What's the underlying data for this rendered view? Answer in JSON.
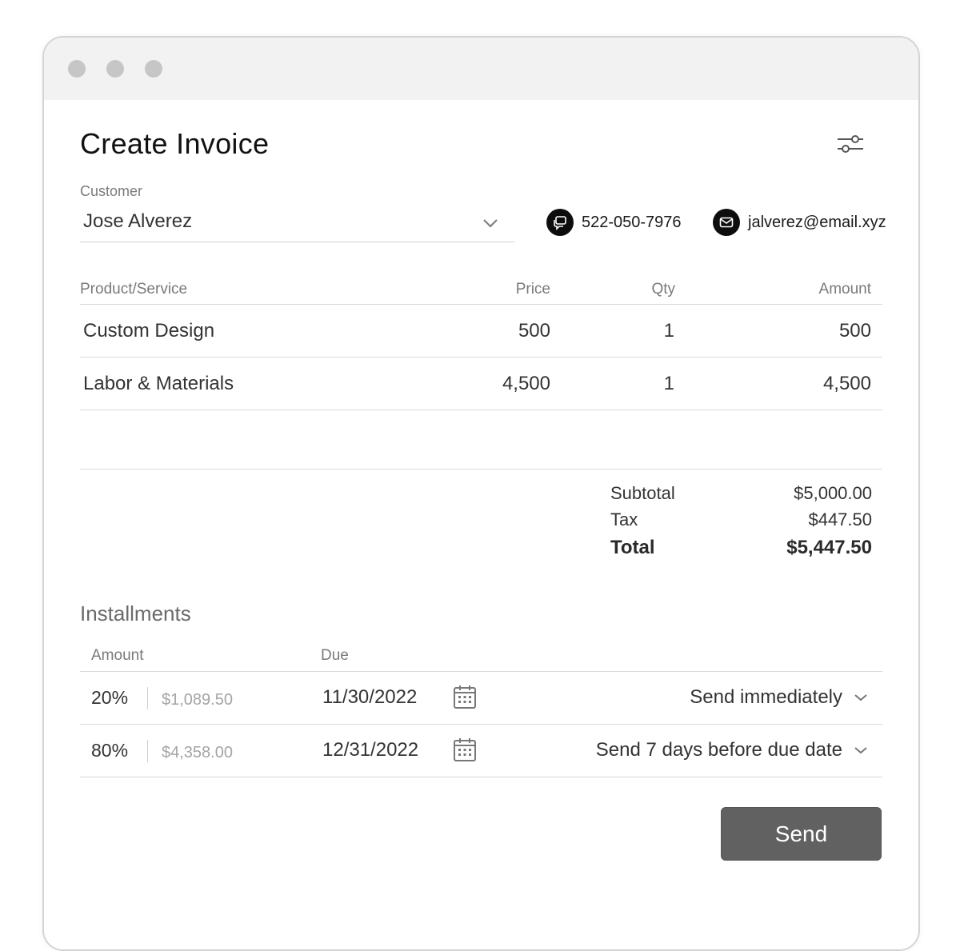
{
  "window": {
    "title": "Create Invoice"
  },
  "customer": {
    "label": "Customer",
    "value": "Jose Alverez"
  },
  "contact": {
    "phone": "522-050-7976",
    "email": "jalverez@email.xyz"
  },
  "items_table": {
    "headers": {
      "product": "Product/Service",
      "price": "Price",
      "qty": "Qty",
      "amount": "Amount"
    },
    "rows": [
      {
        "product": "Custom Design",
        "price": "500",
        "qty": "1",
        "amount": "500"
      },
      {
        "product": "Labor & Materials",
        "price": "4,500",
        "qty": "1",
        "amount": "4,500"
      }
    ]
  },
  "summary": {
    "subtotal_label": "Subtotal",
    "subtotal": "$5,000.00",
    "tax_label": "Tax",
    "tax": "$447.50",
    "total_label": "Total",
    "total": "$5,447.50"
  },
  "installments": {
    "title": "Installments",
    "headers": {
      "amount": "Amount",
      "due": "Due"
    },
    "rows": [
      {
        "percent": "20%",
        "amount": "$1,089.50",
        "due": "11/30/2022",
        "send": "Send immediately"
      },
      {
        "percent": "80%",
        "amount": "$4,358.00",
        "due": "12/31/2022",
        "send": "Send 7 days before due date"
      }
    ]
  },
  "actions": {
    "send_label": "Send"
  },
  "icons": {
    "settings": "sliders-icon",
    "phone": "chat-icon",
    "email": "mail-icon",
    "calendar": "calendar-icon",
    "dropdown": "chevron-down-icon"
  },
  "colors": {
    "button": "#616161",
    "titlebar": "#f2f2f2",
    "dots": "#c6c6c6"
  }
}
